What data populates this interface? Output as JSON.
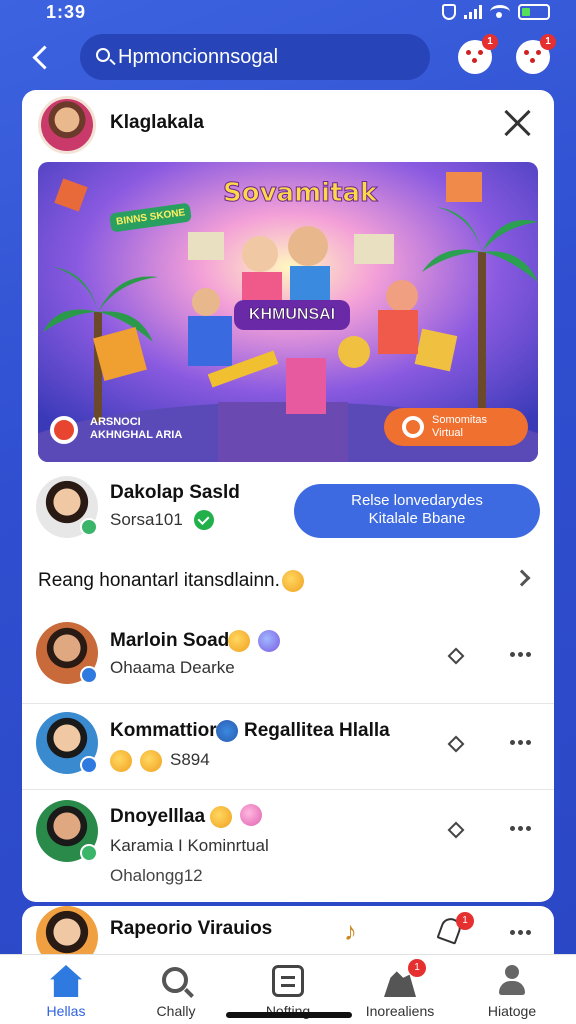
{
  "status_bar": {
    "time": "1:39"
  },
  "search": {
    "placeholder": "Hpmoncionnsogal"
  },
  "notifications": [
    {
      "badge": "1"
    },
    {
      "badge": "1"
    }
  ],
  "card": {
    "header_name": "Klaglakala",
    "banner": {
      "title": "Sovamitak",
      "subtitle": "KHMUNSAI",
      "badge": "BINNS SKONE",
      "left_caption": "ARSNOCI\nAKHNGHAL ARIA",
      "button_label": "Somomitas\nVirtual"
    },
    "profile": {
      "name": "Dakolap Sasld",
      "subtitle": "Sorsa101",
      "action_button": "Relse lonvedarydes\nKitalale Bbane"
    },
    "reason_row": {
      "text": "Reang honantarl itansdlainn."
    },
    "list_items": [
      {
        "name": "Marloin Soad",
        "subtitle": "Ohaama Dearke",
        "extra": ""
      },
      {
        "name": "Kommattior",
        "name2": "Regallitea Hlalla",
        "subtitle": "S894",
        "extra": ""
      },
      {
        "name": "Dnoyelllaa",
        "subtitle": "Karamia I Kominrtual",
        "extra": "Ohalongg12"
      }
    ]
  },
  "card2": {
    "name": "Rapeorio Virauios",
    "badge": "1"
  },
  "bottom_nav": [
    {
      "label": "Hellas",
      "icon": "home-icon"
    },
    {
      "label": "Chally",
      "icon": "search-icon"
    },
    {
      "label": "Nofting",
      "icon": "menu-icon"
    },
    {
      "label": "Inorealiens",
      "icon": "people-icon",
      "badge": "1"
    },
    {
      "label": "Hiatoge",
      "icon": "user-icon"
    }
  ],
  "colors": {
    "accent": "#3d6ae0",
    "background": "#2f4fd0",
    "badge": "#e63030"
  }
}
